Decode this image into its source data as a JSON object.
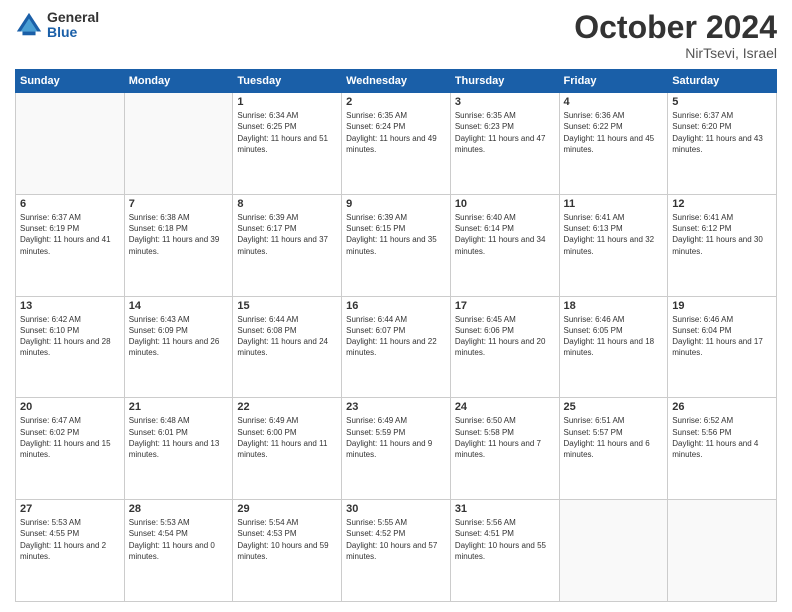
{
  "header": {
    "logo_general": "General",
    "logo_blue": "Blue",
    "month_title": "October 2024",
    "location": "NirTsevi, Israel"
  },
  "days_of_week": [
    "Sunday",
    "Monday",
    "Tuesday",
    "Wednesday",
    "Thursday",
    "Friday",
    "Saturday"
  ],
  "weeks": [
    [
      {
        "day": "",
        "info": ""
      },
      {
        "day": "",
        "info": ""
      },
      {
        "day": "1",
        "info": "Sunrise: 6:34 AM\nSunset: 6:25 PM\nDaylight: 11 hours and 51 minutes."
      },
      {
        "day": "2",
        "info": "Sunrise: 6:35 AM\nSunset: 6:24 PM\nDaylight: 11 hours and 49 minutes."
      },
      {
        "day": "3",
        "info": "Sunrise: 6:35 AM\nSunset: 6:23 PM\nDaylight: 11 hours and 47 minutes."
      },
      {
        "day": "4",
        "info": "Sunrise: 6:36 AM\nSunset: 6:22 PM\nDaylight: 11 hours and 45 minutes."
      },
      {
        "day": "5",
        "info": "Sunrise: 6:37 AM\nSunset: 6:20 PM\nDaylight: 11 hours and 43 minutes."
      }
    ],
    [
      {
        "day": "6",
        "info": "Sunrise: 6:37 AM\nSunset: 6:19 PM\nDaylight: 11 hours and 41 minutes."
      },
      {
        "day": "7",
        "info": "Sunrise: 6:38 AM\nSunset: 6:18 PM\nDaylight: 11 hours and 39 minutes."
      },
      {
        "day": "8",
        "info": "Sunrise: 6:39 AM\nSunset: 6:17 PM\nDaylight: 11 hours and 37 minutes."
      },
      {
        "day": "9",
        "info": "Sunrise: 6:39 AM\nSunset: 6:15 PM\nDaylight: 11 hours and 35 minutes."
      },
      {
        "day": "10",
        "info": "Sunrise: 6:40 AM\nSunset: 6:14 PM\nDaylight: 11 hours and 34 minutes."
      },
      {
        "day": "11",
        "info": "Sunrise: 6:41 AM\nSunset: 6:13 PM\nDaylight: 11 hours and 32 minutes."
      },
      {
        "day": "12",
        "info": "Sunrise: 6:41 AM\nSunset: 6:12 PM\nDaylight: 11 hours and 30 minutes."
      }
    ],
    [
      {
        "day": "13",
        "info": "Sunrise: 6:42 AM\nSunset: 6:10 PM\nDaylight: 11 hours and 28 minutes."
      },
      {
        "day": "14",
        "info": "Sunrise: 6:43 AM\nSunset: 6:09 PM\nDaylight: 11 hours and 26 minutes."
      },
      {
        "day": "15",
        "info": "Sunrise: 6:44 AM\nSunset: 6:08 PM\nDaylight: 11 hours and 24 minutes."
      },
      {
        "day": "16",
        "info": "Sunrise: 6:44 AM\nSunset: 6:07 PM\nDaylight: 11 hours and 22 minutes."
      },
      {
        "day": "17",
        "info": "Sunrise: 6:45 AM\nSunset: 6:06 PM\nDaylight: 11 hours and 20 minutes."
      },
      {
        "day": "18",
        "info": "Sunrise: 6:46 AM\nSunset: 6:05 PM\nDaylight: 11 hours and 18 minutes."
      },
      {
        "day": "19",
        "info": "Sunrise: 6:46 AM\nSunset: 6:04 PM\nDaylight: 11 hours and 17 minutes."
      }
    ],
    [
      {
        "day": "20",
        "info": "Sunrise: 6:47 AM\nSunset: 6:02 PM\nDaylight: 11 hours and 15 minutes."
      },
      {
        "day": "21",
        "info": "Sunrise: 6:48 AM\nSunset: 6:01 PM\nDaylight: 11 hours and 13 minutes."
      },
      {
        "day": "22",
        "info": "Sunrise: 6:49 AM\nSunset: 6:00 PM\nDaylight: 11 hours and 11 minutes."
      },
      {
        "day": "23",
        "info": "Sunrise: 6:49 AM\nSunset: 5:59 PM\nDaylight: 11 hours and 9 minutes."
      },
      {
        "day": "24",
        "info": "Sunrise: 6:50 AM\nSunset: 5:58 PM\nDaylight: 11 hours and 7 minutes."
      },
      {
        "day": "25",
        "info": "Sunrise: 6:51 AM\nSunset: 5:57 PM\nDaylight: 11 hours and 6 minutes."
      },
      {
        "day": "26",
        "info": "Sunrise: 6:52 AM\nSunset: 5:56 PM\nDaylight: 11 hours and 4 minutes."
      }
    ],
    [
      {
        "day": "27",
        "info": "Sunrise: 5:53 AM\nSunset: 4:55 PM\nDaylight: 11 hours and 2 minutes."
      },
      {
        "day": "28",
        "info": "Sunrise: 5:53 AM\nSunset: 4:54 PM\nDaylight: 11 hours and 0 minutes."
      },
      {
        "day": "29",
        "info": "Sunrise: 5:54 AM\nSunset: 4:53 PM\nDaylight: 10 hours and 59 minutes."
      },
      {
        "day": "30",
        "info": "Sunrise: 5:55 AM\nSunset: 4:52 PM\nDaylight: 10 hours and 57 minutes."
      },
      {
        "day": "31",
        "info": "Sunrise: 5:56 AM\nSunset: 4:51 PM\nDaylight: 10 hours and 55 minutes."
      },
      {
        "day": "",
        "info": ""
      },
      {
        "day": "",
        "info": ""
      }
    ]
  ]
}
